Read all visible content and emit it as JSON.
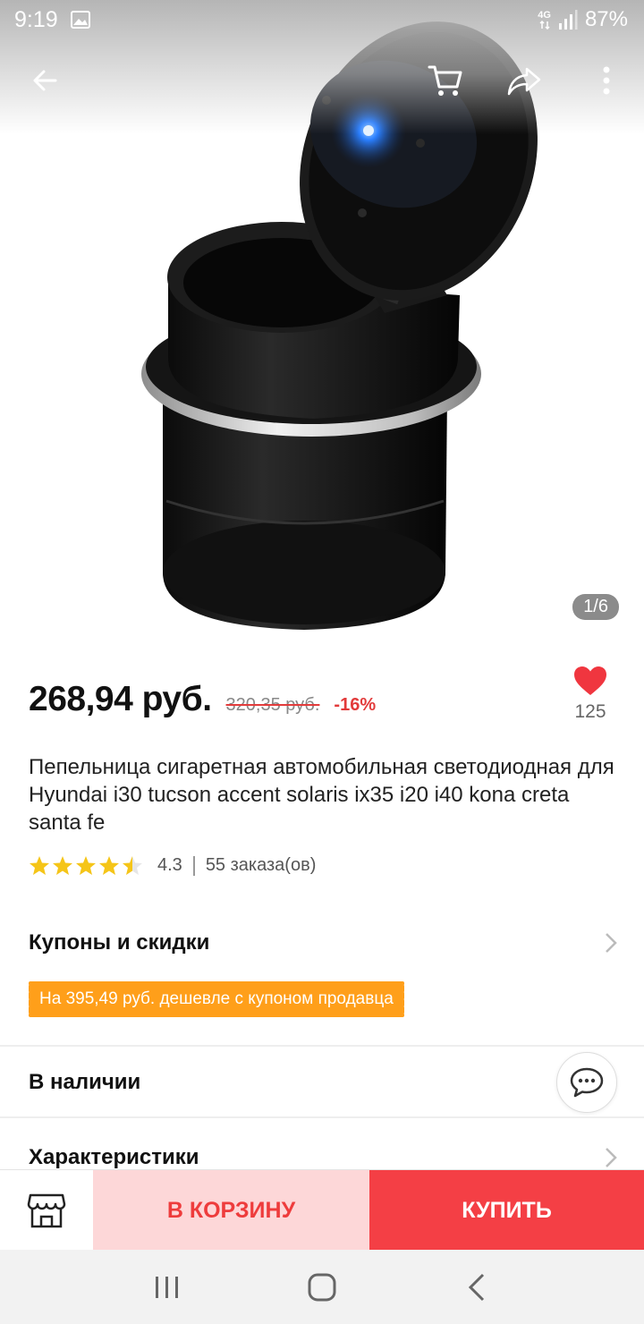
{
  "status_bar": {
    "time": "9:19",
    "network": "4G",
    "battery": "87%"
  },
  "gallery": {
    "page_indicator": "1/6",
    "product_image": "black-car-ashtray-with-blue-led-lid"
  },
  "product": {
    "price": "268,94 руб.",
    "old_price": "320,35 руб.",
    "discount": "-16%",
    "favorites_count": "125",
    "title": "Пепельница сигаретная автомобильная светодиодная для Hyundai i30 tucson accent solaris ix35 i20 i40 kona creta santa fe",
    "rating": "4.3",
    "rating_stars": 4.3,
    "orders": "55 заказа(ов)"
  },
  "sections": {
    "coupons_title": "Купоны и скидки",
    "coupon_badge": "На 395,49 руб. дешевле с купоном продавца",
    "stock_title": "В наличии",
    "specs_title": "Характеристики"
  },
  "actions": {
    "cart_label": "В КОРЗИНУ",
    "buy_label": "КУПИТЬ"
  },
  "colors": {
    "accent_red": "#f43f45",
    "cart_bg": "#fdd7d8",
    "coupon_orange": "#ff9f1a",
    "star_yellow": "#f5c518"
  }
}
